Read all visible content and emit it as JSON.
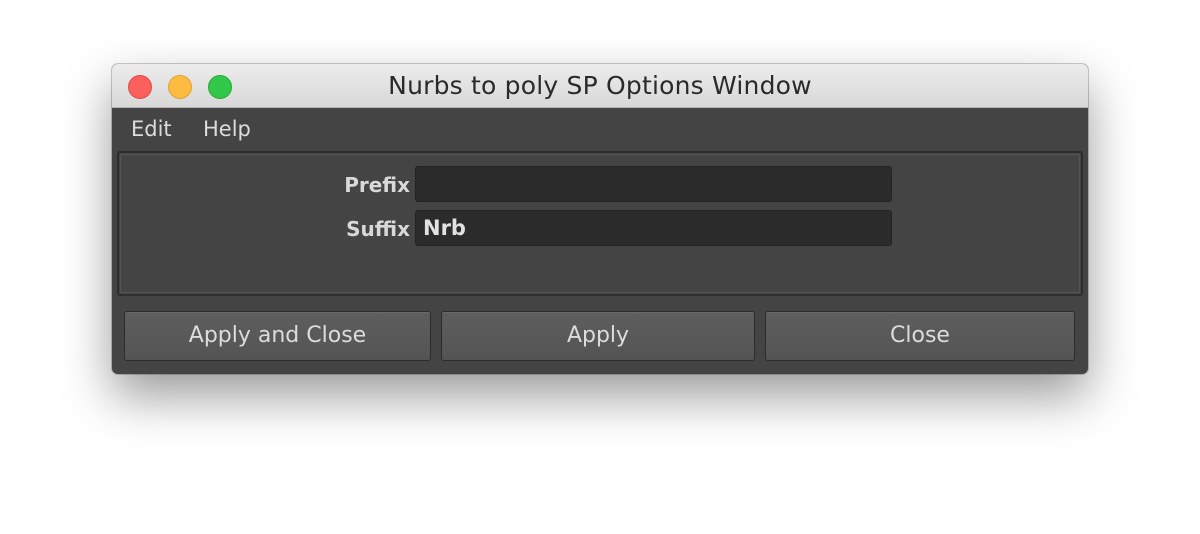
{
  "window": {
    "title": "Nurbs to poly SP Options Window",
    "controls": [
      "close-button",
      "minimize-button",
      "zoom-button"
    ]
  },
  "menu": {
    "items": [
      {
        "label": "Edit"
      },
      {
        "label": "Help"
      }
    ]
  },
  "form": {
    "prefix": {
      "label": "Prefix",
      "value": ""
    },
    "suffix": {
      "label": "Suffix",
      "value": "Nrb"
    }
  },
  "buttons": {
    "apply_and_close": "Apply and Close",
    "apply": "Apply",
    "close": "Close"
  },
  "colors": {
    "traffic_close": "#fc605c",
    "traffic_minimize": "#fdbc40",
    "traffic_zoom": "#34c84a",
    "panel_bg": "#444444",
    "field_bg": "#2b2b2b"
  }
}
